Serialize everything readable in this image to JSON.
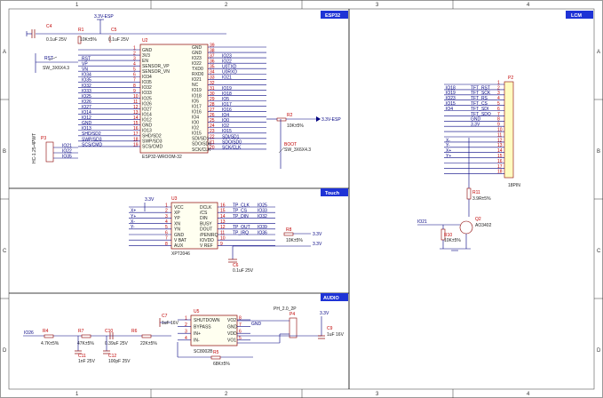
{
  "sections": {
    "esp32": "ESP32",
    "lcm": "LCM",
    "touch": "Touch",
    "audio": "AUDIO"
  },
  "ruler": {
    "columns": [
      "1",
      "2",
      "3",
      "4"
    ],
    "rows": [
      "A",
      "B",
      "C",
      "D"
    ]
  },
  "esp32": {
    "ref": "U2",
    "part": "ESP32-WROOM-32",
    "net_3v3": "3.3V-ESP",
    "c4": {
      "ref": "C4",
      "value": "0.1uF 25V"
    },
    "r1": {
      "ref": "R1",
      "value": "10K±5%"
    },
    "c5": {
      "ref": "C5",
      "value": "0.1uF 25V"
    },
    "rst_net": "RST",
    "sw_rst": "SW_3X6X4.3",
    "boot": {
      "ref": "R2",
      "value": "10K±5%",
      "label": "BOOT",
      "sw": "SW_3X6X4.3",
      "net": "3.3V-ESP"
    },
    "left_pins": [
      {
        "num": "1",
        "name": "GND",
        "net": ""
      },
      {
        "num": "2",
        "name": "3V3",
        "net": ""
      },
      {
        "num": "3",
        "name": "EN",
        "net": "RST"
      },
      {
        "num": "4",
        "name": "SENSOR_VP",
        "net": "VP"
      },
      {
        "num": "5",
        "name": "SENSOR_VN",
        "net": "VN"
      },
      {
        "num": "6",
        "name": "IO34",
        "net": "IO34"
      },
      {
        "num": "7",
        "name": "IO35",
        "net": "IO35"
      },
      {
        "num": "8",
        "name": "IO32",
        "net": "IO32"
      },
      {
        "num": "9",
        "name": "IO33",
        "net": "IO33"
      },
      {
        "num": "10",
        "name": "IO25",
        "net": "IO25"
      },
      {
        "num": "11",
        "name": "IO26",
        "net": "IO26"
      },
      {
        "num": "12",
        "name": "IO27",
        "net": "IO27"
      },
      {
        "num": "13",
        "name": "IO14",
        "net": "IO14"
      },
      {
        "num": "14",
        "name": "IO12",
        "net": "IO12"
      },
      {
        "num": "15",
        "name": "GND",
        "net": "GND"
      },
      {
        "num": "16",
        "name": "IO13",
        "net": "IO13"
      },
      {
        "num": "17",
        "name": "SHD/SD2",
        "net": "SHD/SD2"
      },
      {
        "num": "18",
        "name": "SWP/SD3",
        "net": "SWP/SD3"
      },
      {
        "num": "19",
        "name": "SCS/CMD",
        "net": "SCS/CMD"
      }
    ],
    "right_pins": [
      {
        "num": "39",
        "name": "GND",
        "net": ""
      },
      {
        "num": "38",
        "name": "GND",
        "net": ""
      },
      {
        "num": "37",
        "name": "IO23",
        "net": "IO23"
      },
      {
        "num": "36",
        "name": "IO22",
        "net": "IO22"
      },
      {
        "num": "35",
        "name": "TXD0",
        "net": "U0TXD"
      },
      {
        "num": "34",
        "name": "RXD0",
        "net": "U0RXD"
      },
      {
        "num": "33",
        "name": "IO21",
        "net": "IO21"
      },
      {
        "num": "32",
        "name": "NC",
        "net": ""
      },
      {
        "num": "31",
        "name": "IO19",
        "net": "IO19"
      },
      {
        "num": "30",
        "name": "IO18",
        "net": "IO18"
      },
      {
        "num": "29",
        "name": "IO5",
        "net": "IO5"
      },
      {
        "num": "28",
        "name": "IO17",
        "net": "IO17"
      },
      {
        "num": "27",
        "name": "IO16",
        "net": "IO16"
      },
      {
        "num": "26",
        "name": "IO4",
        "net": "IO4"
      },
      {
        "num": "25",
        "name": "IO0",
        "net": "IO0"
      },
      {
        "num": "24",
        "name": "IO2",
        "net": "IO2"
      },
      {
        "num": "23",
        "name": "IO15",
        "net": "IO15"
      },
      {
        "num": "22",
        "name": "SDI/SD1",
        "net": "SDI/SD1"
      },
      {
        "num": "21",
        "name": "SDO/SD0",
        "net": "SDO/SD0"
      },
      {
        "num": "20",
        "name": "SCK/CLK",
        "net": "SCK/CLK"
      }
    ],
    "p3": {
      "ref": "P3",
      "part": "HC-1.25-4PWT",
      "nets": [
        "IO21",
        "IO22",
        "IO35"
      ]
    }
  },
  "lcm": {
    "ref": "P2",
    "part": "18PIN",
    "nets": [
      "",
      "TFT_RST",
      "TFT_SCK",
      "TFT_RS",
      "TFT_CS",
      "TFT_SDI",
      "TFT_SDO",
      "GND",
      "3.3V",
      "",
      "",
      "",
      "",
      "",
      "",
      "",
      "",
      ""
    ],
    "left_nets": [
      "",
      "IO18",
      "IO19",
      "IO23",
      "IO15",
      "IO4",
      "",
      "",
      "",
      "",
      "",
      "X-",
      "Y-",
      "X+",
      "Y+",
      "",
      "",
      ""
    ],
    "r11": {
      "ref": "R11",
      "value": "3.9R±5%"
    },
    "r10": {
      "ref": "R10",
      "value": "10K±5%"
    },
    "q2": {
      "ref": "Q2",
      "part": "AO3402"
    },
    "bl_net": "IO21"
  },
  "touch": {
    "ref": "U3",
    "part": "XPT2046",
    "vcc_net": "3.3V",
    "left_pins": [
      {
        "num": "1",
        "name": "VCC",
        "net": ""
      },
      {
        "num": "2",
        "name": "XP",
        "net": "X+"
      },
      {
        "num": "3",
        "name": "YP",
        "net": "Y+"
      },
      {
        "num": "4",
        "name": "XN",
        "net": "X-"
      },
      {
        "num": "5",
        "name": "YN",
        "net": "Y-"
      },
      {
        "num": "6",
        "name": "GND",
        "net": ""
      },
      {
        "num": "7",
        "name": "V BAT",
        "net": ""
      },
      {
        "num": "8",
        "name": "AUX",
        "net": ""
      }
    ],
    "right_pins": [
      {
        "num": "16",
        "name": "DCLK",
        "net": "TP_CLK",
        "io": "IO25"
      },
      {
        "num": "15",
        "name": "/CS",
        "net": "TP_CS",
        "io": "IO33"
      },
      {
        "num": "14",
        "name": "DIN",
        "net": "TP_DIN",
        "io": "IO32"
      },
      {
        "num": "13",
        "name": "BUSY",
        "net": "",
        "io": ""
      },
      {
        "num": "12",
        "name": "DOUT",
        "net": "TP_OUT",
        "io": "IO39"
      },
      {
        "num": "11",
        "name": "/PENIRQ",
        "net": "TP_IRQ",
        "io": "IO36"
      },
      {
        "num": "10",
        "name": "IOVDD",
        "net": "",
        "io": ""
      },
      {
        "num": "9",
        "name": "V REF",
        "net": "",
        "io": ""
      }
    ],
    "r8": {
      "ref": "R8",
      "value": "10K±5%"
    },
    "c6": {
      "ref": "C6",
      "value": "0.1uF 25V"
    },
    "net_33": "3.3V"
  },
  "audio": {
    "ref": "U5",
    "part": "SC8002B",
    "in_net": "IO26",
    "r4": {
      "ref": "R4",
      "value": "4.7K±5%"
    },
    "r7": {
      "ref": "R7",
      "value": "47K±5%"
    },
    "c10": {
      "ref": "C10",
      "value": "0.39uF 25V"
    },
    "r6": {
      "ref": "R6",
      "value": "22K±5%"
    },
    "r5": {
      "ref": "R5",
      "value": "68K±5%"
    },
    "c7": {
      "ref": "C7",
      "value": "1uF 16V"
    },
    "c11": {
      "ref": "C11",
      "value": "1nF 25V"
    },
    "c12": {
      "ref": "C12",
      "value": "100pF 25V"
    },
    "c9": {
      "ref": "C9",
      "value": "1uF 16V"
    },
    "p4": {
      "ref": "P4",
      "part": "PH_2.0_2P"
    },
    "net_33": "3.3V",
    "pins_left": [
      {
        "num": "1",
        "name": "SHUTDOWN"
      },
      {
        "num": "2",
        "name": "BYPASS"
      },
      {
        "num": "3",
        "name": "IN+"
      },
      {
        "num": "4",
        "name": "IN-"
      }
    ],
    "pins_right": [
      {
        "num": "8",
        "name": "VO2"
      },
      {
        "num": "7",
        "name": "GND"
      },
      {
        "num": "6",
        "name": "VDD"
      },
      {
        "num": "5",
        "name": "VO1"
      }
    ],
    "gnd_net": "GND"
  }
}
